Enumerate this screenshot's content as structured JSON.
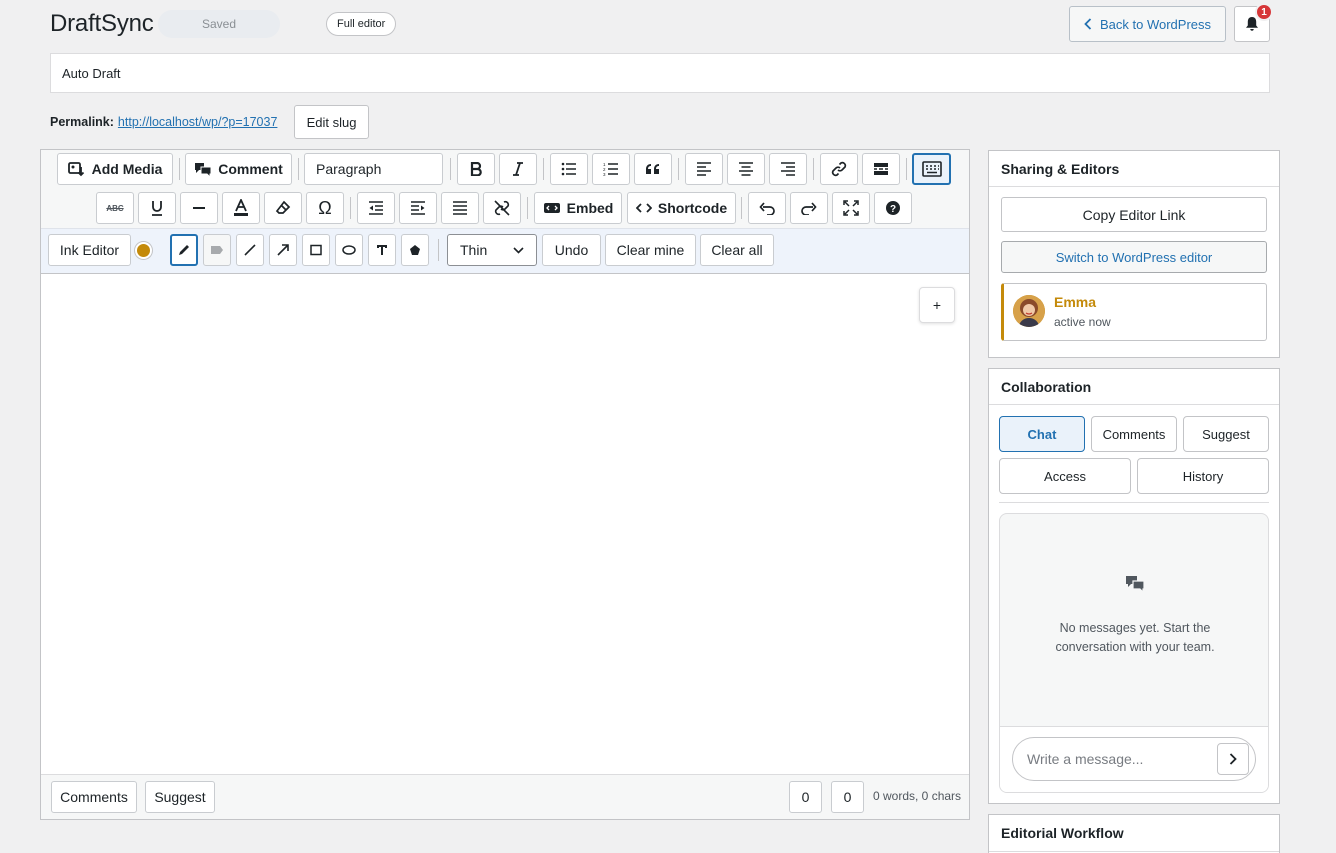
{
  "header": {
    "app_title": "DraftSync",
    "save_status": "Saved",
    "full_editor_label": "Full editor",
    "back_label": "Back to WordPress",
    "notification_count": "1"
  },
  "post": {
    "title": "Auto Draft",
    "permalink_label": "Permalink:",
    "permalink_url": "http://localhost/wp/?p=17037",
    "edit_slug_label": "Edit slug"
  },
  "toolbar": {
    "add_media": "Add Media",
    "comment": "Comment",
    "format_select": "Paragraph",
    "embed": "Embed",
    "shortcode": "Shortcode",
    "icons_row1": [
      "bold-icon",
      "italic-icon",
      "bullet-list-icon",
      "numbered-list-icon",
      "blockquote-icon",
      "align-left-icon",
      "align-center-icon",
      "align-right-icon",
      "link-icon",
      "read-more-icon",
      "toolbar-toggle-icon"
    ],
    "icons_row2": [
      "strikethrough-icon",
      "underline-icon",
      "horizontal-rule-icon",
      "text-color-icon",
      "clear-formatting-icon",
      "special-character-icon",
      "outdent-icon",
      "indent-icon",
      "justify-icon",
      "unlink-icon",
      "undo-icon",
      "redo-icon",
      "fullscreen-icon",
      "help-icon"
    ]
  },
  "ink": {
    "label": "Ink Editor",
    "color": "#c48a0a",
    "stroke_select": "Thin",
    "undo": "Undo",
    "clear_mine": "Clear mine",
    "clear_all": "Clear all",
    "tools": [
      "pen-icon",
      "highlighter-icon",
      "line-icon",
      "arrow-icon",
      "rectangle-icon",
      "ellipse-icon",
      "text-tool-icon",
      "fill-icon"
    ]
  },
  "editor_footer": {
    "comments": "Comments",
    "suggest": "Suggest",
    "count_a": "0",
    "count_b": "0",
    "word_count": "0 words, 0 chars"
  },
  "sharing": {
    "title": "Sharing & Editors",
    "copy_link": "Copy Editor Link",
    "switch_editor": "Switch to WordPress editor",
    "user_name": "Emma",
    "user_status": "active now"
  },
  "collab": {
    "title": "Collaboration",
    "tabs": [
      "Chat",
      "Comments",
      "Suggest",
      "Access",
      "History"
    ],
    "empty_message": "No messages yet. Start the conversation with your team.",
    "input_placeholder": "Write a message..."
  },
  "workflow": {
    "title": "Editorial Workflow"
  },
  "colors": {
    "accent": "#2271b1",
    "badge": "#d63638",
    "user_accent": "#c48a0a"
  }
}
